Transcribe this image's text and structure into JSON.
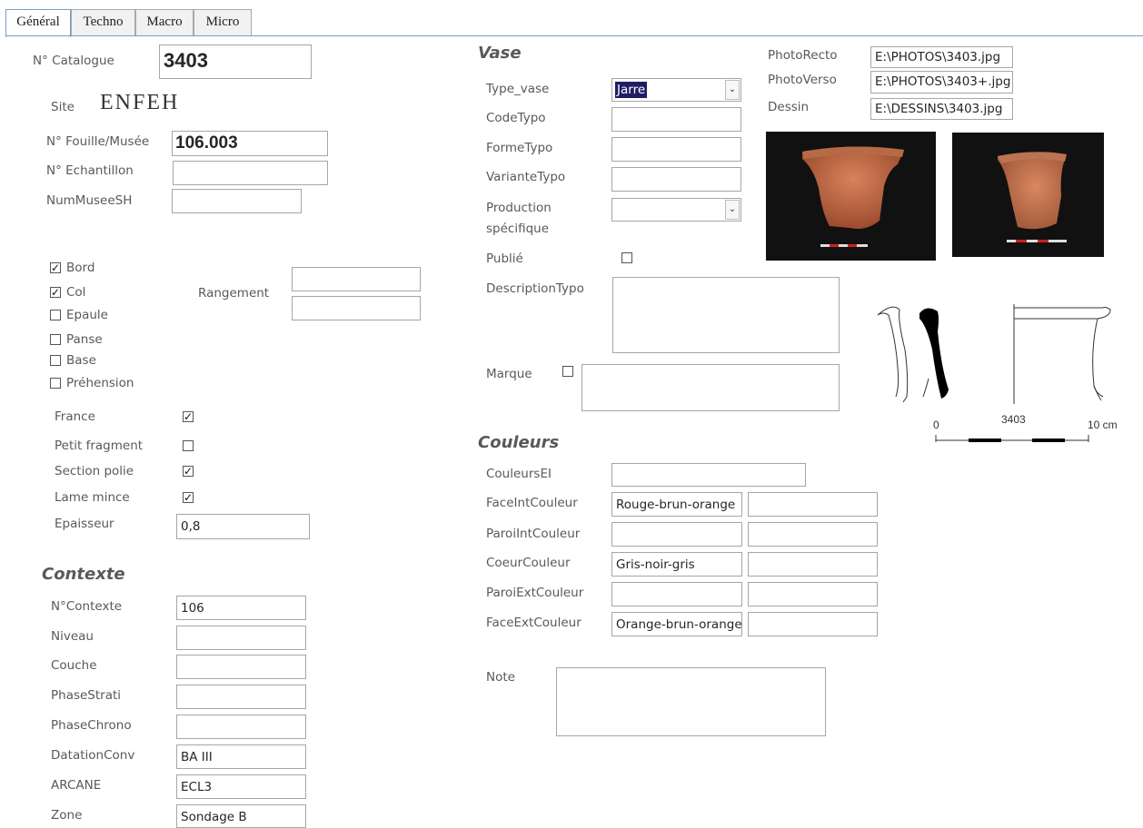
{
  "tabs": [
    "Général",
    "Techno",
    "Macro",
    "Micro"
  ],
  "general": {
    "catalogue_label": "N° Catalogue",
    "catalogue_value": "3403",
    "site_label": "Site",
    "site_value": "ENFEH",
    "fouille_label": "N° Fouille/Musée",
    "fouille_value": "106.003",
    "echantillon_label": "N° Echantillon",
    "echantillon_value": "",
    "nummusee_label": "NumMuseeSH",
    "nummusee_value": ""
  },
  "parts": [
    {
      "label": "Bord",
      "checked": true
    },
    {
      "label": "Col",
      "checked": true
    },
    {
      "label": "Epaule",
      "checked": false
    },
    {
      "label": "Panse",
      "checked": false
    },
    {
      "label": "Base",
      "checked": false
    },
    {
      "label": "Préhension",
      "checked": false
    }
  ],
  "rangement_label": "Rangement",
  "flags": [
    {
      "label": "France",
      "checked": true
    },
    {
      "label": "Petit fragment",
      "checked": false
    },
    {
      "label": "Section polie",
      "checked": true
    },
    {
      "label": "Lame mince",
      "checked": true
    }
  ],
  "epaisseur_label": "Epaisseur",
  "epaisseur_value": "0,8",
  "contexte": {
    "title": "Contexte",
    "fields": [
      {
        "label": "N°Contexte",
        "value": "106"
      },
      {
        "label": "Niveau",
        "value": ""
      },
      {
        "label": "Couche",
        "value": ""
      },
      {
        "label": "PhaseStrati",
        "value": ""
      },
      {
        "label": "PhaseChrono",
        "value": ""
      },
      {
        "label": "DatationConv",
        "value": "BA III"
      },
      {
        "label": "ARCANE",
        "value": "ECL3"
      },
      {
        "label": "Zone",
        "value": "Sondage B"
      }
    ]
  },
  "vase": {
    "title": "Vase",
    "type_label": "Type_vase",
    "type_value": "Jarre",
    "codetypo_label": "CodeTypo",
    "formetypo_label": "FormeTypo",
    "variantetypo_label": "VarianteTypo",
    "production_label_1": "Production",
    "production_label_2": "spécifique",
    "publie_label": "Publié",
    "publie_checked": false,
    "description_label": "DescriptionTypo",
    "marque_label": "Marque",
    "marque_checked": false
  },
  "photos": {
    "recto_label": "PhotoRecto",
    "recto_value": "E:\\PHOTOS\\3403.jpg",
    "verso_label": "PhotoVerso",
    "verso_value": "E:\\PHOTOS\\3403+.jpg",
    "dessin_label": "Dessin",
    "dessin_value": "E:\\DESSINS\\3403.jpg"
  },
  "drawing": {
    "id_label": "3403",
    "scale_start": "0",
    "scale_end": "10 cm"
  },
  "couleurs": {
    "title": "Couleurs",
    "couleursei_label": "CouleursEI",
    "rows": [
      {
        "label": "FaceIntCouleur",
        "value": "Rouge-brun-orange",
        "value2": ""
      },
      {
        "label": "ParoiIntCouleur",
        "value": "",
        "value2": ""
      },
      {
        "label": "CoeurCouleur",
        "value": "Gris-noir-gris",
        "value2": ""
      },
      {
        "label": "ParoiExtCouleur",
        "value": "",
        "value2": ""
      },
      {
        "label": "FaceExtCouleur",
        "value": "Orange-brun-orange",
        "value2": ""
      }
    ]
  },
  "note_label": "Note"
}
